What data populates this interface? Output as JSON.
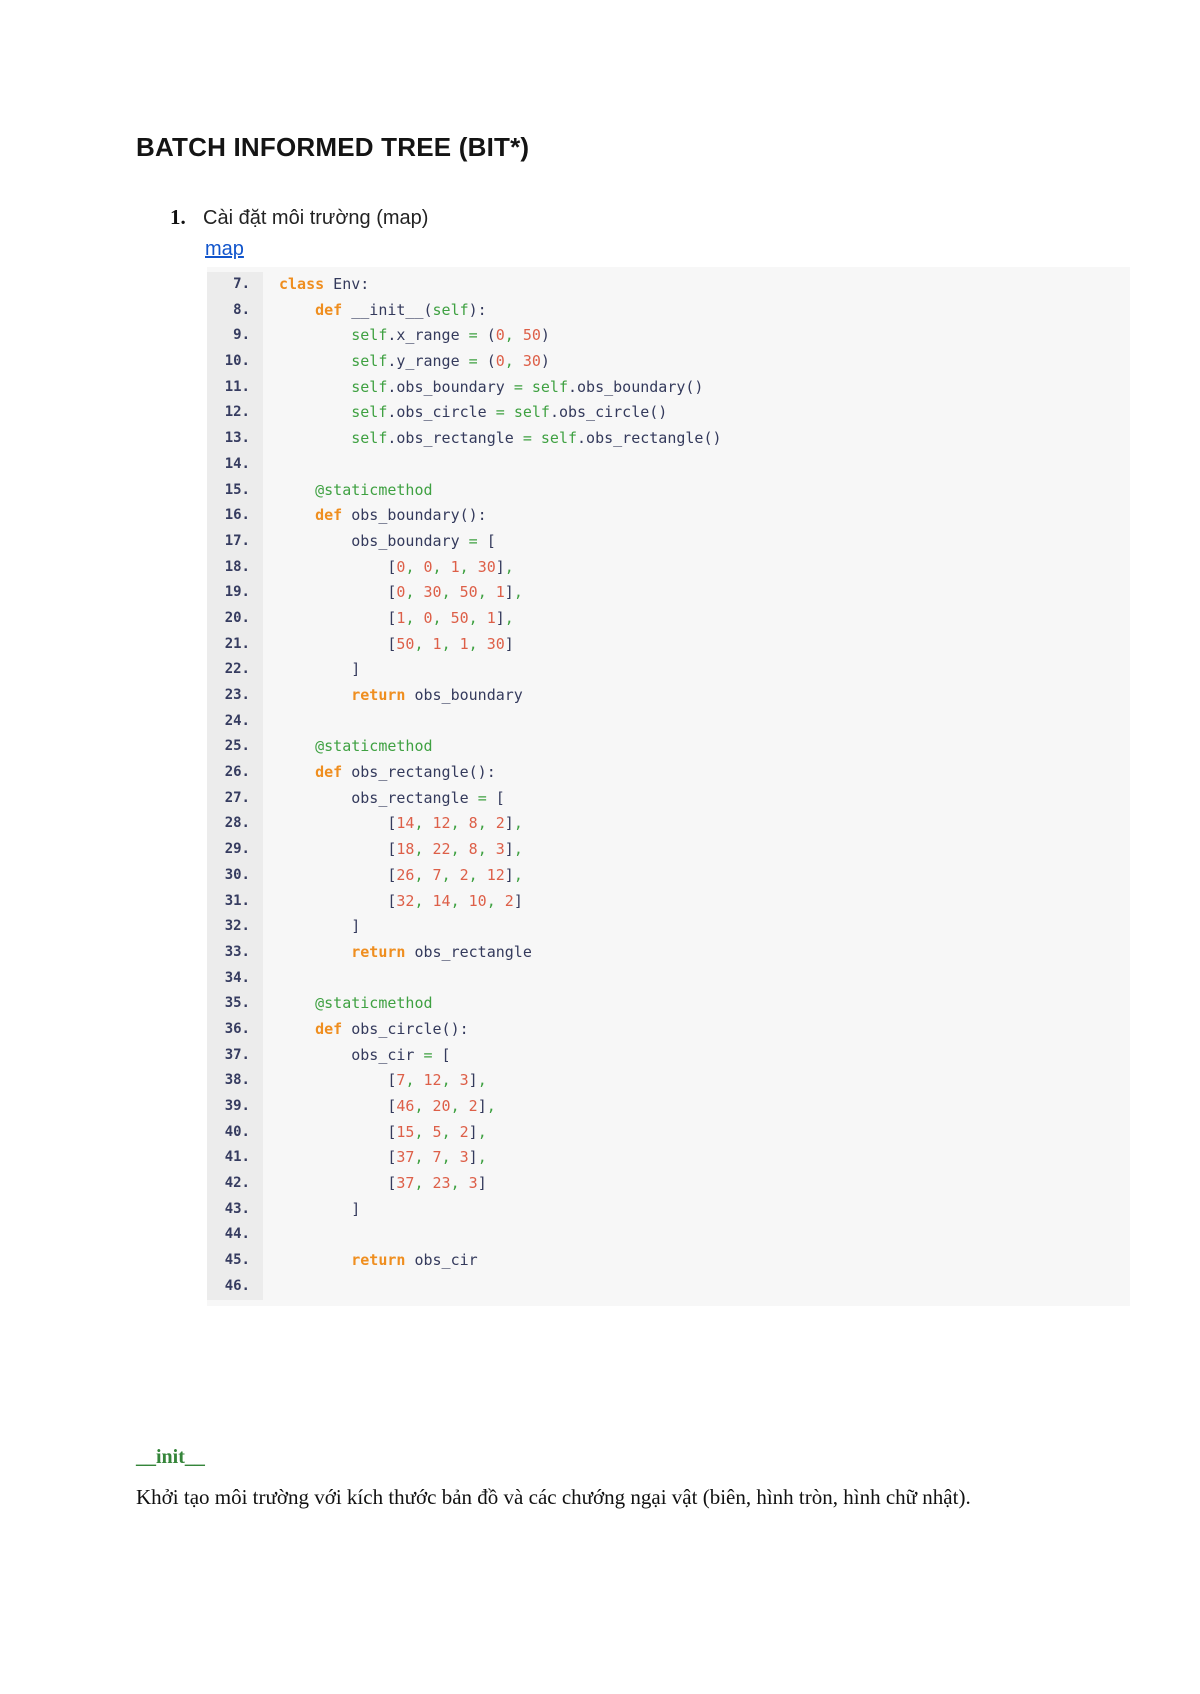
{
  "page": {
    "title": "BATCH INFORMED TREE (BIT*)",
    "list_item": {
      "number": "1.",
      "text": "Cài đặt môi trường (map)"
    },
    "link_label": "map"
  },
  "colors": {
    "keyword": "#ef8e1f",
    "number": "#dd5f48",
    "green": "#3fa142",
    "code_default": "#343a5c",
    "line_number": "#363c60",
    "code_bg": "#f7f7f7",
    "gutter_bg": "#ececec",
    "link": "#1155cc",
    "init_green": "#35853a"
  },
  "code_block": {
    "language": "python",
    "lines": [
      {
        "no": "7.",
        "segs": [
          [
            "k",
            "class"
          ],
          [
            "d",
            " Env:"
          ]
        ]
      },
      {
        "no": "8.",
        "segs": [
          [
            "d",
            "    "
          ],
          [
            "k",
            "def"
          ],
          [
            "d",
            " __init__("
          ],
          [
            "g",
            "self"
          ],
          [
            "d",
            "):"
          ]
        ]
      },
      {
        "no": "9.",
        "segs": [
          [
            "d",
            "        "
          ],
          [
            "g",
            "self"
          ],
          [
            "d",
            ".x_range "
          ],
          [
            "g",
            "="
          ],
          [
            "d",
            " ("
          ],
          [
            "n",
            "0"
          ],
          [
            "g",
            ","
          ],
          [
            "d",
            " "
          ],
          [
            "n",
            "50"
          ],
          [
            "d",
            ")"
          ]
        ]
      },
      {
        "no": "10.",
        "segs": [
          [
            "d",
            "        "
          ],
          [
            "g",
            "self"
          ],
          [
            "d",
            ".y_range "
          ],
          [
            "g",
            "="
          ],
          [
            "d",
            " ("
          ],
          [
            "n",
            "0"
          ],
          [
            "g",
            ","
          ],
          [
            "d",
            " "
          ],
          [
            "n",
            "30"
          ],
          [
            "d",
            ")"
          ]
        ]
      },
      {
        "no": "11.",
        "segs": [
          [
            "d",
            "        "
          ],
          [
            "g",
            "self"
          ],
          [
            "d",
            ".obs_boundary "
          ],
          [
            "g",
            "="
          ],
          [
            "d",
            " "
          ],
          [
            "g",
            "self"
          ],
          [
            "d",
            ".obs_boundary()"
          ]
        ]
      },
      {
        "no": "12.",
        "segs": [
          [
            "d",
            "        "
          ],
          [
            "g",
            "self"
          ],
          [
            "d",
            ".obs_circle "
          ],
          [
            "g",
            "="
          ],
          [
            "d",
            " "
          ],
          [
            "g",
            "self"
          ],
          [
            "d",
            ".obs_circle()"
          ]
        ]
      },
      {
        "no": "13.",
        "segs": [
          [
            "d",
            "        "
          ],
          [
            "g",
            "self"
          ],
          [
            "d",
            ".obs_rectangle "
          ],
          [
            "g",
            "="
          ],
          [
            "d",
            " "
          ],
          [
            "g",
            "self"
          ],
          [
            "d",
            ".obs_rectangle()"
          ]
        ]
      },
      {
        "no": "14.",
        "segs": []
      },
      {
        "no": "15.",
        "segs": [
          [
            "d",
            "    "
          ],
          [
            "g",
            "@staticmethod"
          ]
        ]
      },
      {
        "no": "16.",
        "segs": [
          [
            "d",
            "    "
          ],
          [
            "k",
            "def"
          ],
          [
            "d",
            " obs_boundary():"
          ]
        ]
      },
      {
        "no": "17.",
        "segs": [
          [
            "d",
            "        obs_boundary "
          ],
          [
            "g",
            "="
          ],
          [
            "d",
            " ["
          ]
        ]
      },
      {
        "no": "18.",
        "segs": [
          [
            "d",
            "            ["
          ],
          [
            "n",
            "0"
          ],
          [
            "g",
            ","
          ],
          [
            "d",
            " "
          ],
          [
            "n",
            "0"
          ],
          [
            "g",
            ","
          ],
          [
            "d",
            " "
          ],
          [
            "n",
            "1"
          ],
          [
            "g",
            ","
          ],
          [
            "d",
            " "
          ],
          [
            "n",
            "30"
          ],
          [
            "d",
            "]"
          ],
          [
            "g",
            ","
          ]
        ]
      },
      {
        "no": "19.",
        "segs": [
          [
            "d",
            "            ["
          ],
          [
            "n",
            "0"
          ],
          [
            "g",
            ","
          ],
          [
            "d",
            " "
          ],
          [
            "n",
            "30"
          ],
          [
            "g",
            ","
          ],
          [
            "d",
            " "
          ],
          [
            "n",
            "50"
          ],
          [
            "g",
            ","
          ],
          [
            "d",
            " "
          ],
          [
            "n",
            "1"
          ],
          [
            "d",
            "]"
          ],
          [
            "g",
            ","
          ]
        ]
      },
      {
        "no": "20.",
        "segs": [
          [
            "d",
            "            ["
          ],
          [
            "n",
            "1"
          ],
          [
            "g",
            ","
          ],
          [
            "d",
            " "
          ],
          [
            "n",
            "0"
          ],
          [
            "g",
            ","
          ],
          [
            "d",
            " "
          ],
          [
            "n",
            "50"
          ],
          [
            "g",
            ","
          ],
          [
            "d",
            " "
          ],
          [
            "n",
            "1"
          ],
          [
            "d",
            "]"
          ],
          [
            "g",
            ","
          ]
        ]
      },
      {
        "no": "21.",
        "segs": [
          [
            "d",
            "            ["
          ],
          [
            "n",
            "50"
          ],
          [
            "g",
            ","
          ],
          [
            "d",
            " "
          ],
          [
            "n",
            "1"
          ],
          [
            "g",
            ","
          ],
          [
            "d",
            " "
          ],
          [
            "n",
            "1"
          ],
          [
            "g",
            ","
          ],
          [
            "d",
            " "
          ],
          [
            "n",
            "30"
          ],
          [
            "d",
            "]"
          ]
        ]
      },
      {
        "no": "22.",
        "segs": [
          [
            "d",
            "        ]"
          ]
        ]
      },
      {
        "no": "23.",
        "segs": [
          [
            "d",
            "        "
          ],
          [
            "k",
            "return"
          ],
          [
            "d",
            " obs_boundary"
          ]
        ]
      },
      {
        "no": "24.",
        "segs": []
      },
      {
        "no": "25.",
        "segs": [
          [
            "d",
            "    "
          ],
          [
            "g",
            "@staticmethod"
          ]
        ]
      },
      {
        "no": "26.",
        "segs": [
          [
            "d",
            "    "
          ],
          [
            "k",
            "def"
          ],
          [
            "d",
            " obs_rectangle():"
          ]
        ]
      },
      {
        "no": "27.",
        "segs": [
          [
            "d",
            "        obs_rectangle "
          ],
          [
            "g",
            "="
          ],
          [
            "d",
            " ["
          ]
        ]
      },
      {
        "no": "28.",
        "segs": [
          [
            "d",
            "            ["
          ],
          [
            "n",
            "14"
          ],
          [
            "g",
            ","
          ],
          [
            "d",
            " "
          ],
          [
            "n",
            "12"
          ],
          [
            "g",
            ","
          ],
          [
            "d",
            " "
          ],
          [
            "n",
            "8"
          ],
          [
            "g",
            ","
          ],
          [
            "d",
            " "
          ],
          [
            "n",
            "2"
          ],
          [
            "d",
            "]"
          ],
          [
            "g",
            ","
          ]
        ]
      },
      {
        "no": "29.",
        "segs": [
          [
            "d",
            "            ["
          ],
          [
            "n",
            "18"
          ],
          [
            "g",
            ","
          ],
          [
            "d",
            " "
          ],
          [
            "n",
            "22"
          ],
          [
            "g",
            ","
          ],
          [
            "d",
            " "
          ],
          [
            "n",
            "8"
          ],
          [
            "g",
            ","
          ],
          [
            "d",
            " "
          ],
          [
            "n",
            "3"
          ],
          [
            "d",
            "]"
          ],
          [
            "g",
            ","
          ]
        ]
      },
      {
        "no": "30.",
        "segs": [
          [
            "d",
            "            ["
          ],
          [
            "n",
            "26"
          ],
          [
            "g",
            ","
          ],
          [
            "d",
            " "
          ],
          [
            "n",
            "7"
          ],
          [
            "g",
            ","
          ],
          [
            "d",
            " "
          ],
          [
            "n",
            "2"
          ],
          [
            "g",
            ","
          ],
          [
            "d",
            " "
          ],
          [
            "n",
            "12"
          ],
          [
            "d",
            "]"
          ],
          [
            "g",
            ","
          ]
        ]
      },
      {
        "no": "31.",
        "segs": [
          [
            "d",
            "            ["
          ],
          [
            "n",
            "32"
          ],
          [
            "g",
            ","
          ],
          [
            "d",
            " "
          ],
          [
            "n",
            "14"
          ],
          [
            "g",
            ","
          ],
          [
            "d",
            " "
          ],
          [
            "n",
            "10"
          ],
          [
            "g",
            ","
          ],
          [
            "d",
            " "
          ],
          [
            "n",
            "2"
          ],
          [
            "d",
            "]"
          ]
        ]
      },
      {
        "no": "32.",
        "segs": [
          [
            "d",
            "        ]"
          ]
        ]
      },
      {
        "no": "33.",
        "segs": [
          [
            "d",
            "        "
          ],
          [
            "k",
            "return"
          ],
          [
            "d",
            " obs_rectangle"
          ]
        ]
      },
      {
        "no": "34.",
        "segs": []
      },
      {
        "no": "35.",
        "segs": [
          [
            "d",
            "    "
          ],
          [
            "g",
            "@staticmethod"
          ]
        ]
      },
      {
        "no": "36.",
        "segs": [
          [
            "d",
            "    "
          ],
          [
            "k",
            "def"
          ],
          [
            "d",
            " obs_circle():"
          ]
        ]
      },
      {
        "no": "37.",
        "segs": [
          [
            "d",
            "        obs_cir "
          ],
          [
            "g",
            "="
          ],
          [
            "d",
            " ["
          ]
        ]
      },
      {
        "no": "38.",
        "segs": [
          [
            "d",
            "            ["
          ],
          [
            "n",
            "7"
          ],
          [
            "g",
            ","
          ],
          [
            "d",
            " "
          ],
          [
            "n",
            "12"
          ],
          [
            "g",
            ","
          ],
          [
            "d",
            " "
          ],
          [
            "n",
            "3"
          ],
          [
            "d",
            "]"
          ],
          [
            "g",
            ","
          ]
        ]
      },
      {
        "no": "39.",
        "segs": [
          [
            "d",
            "            ["
          ],
          [
            "n",
            "46"
          ],
          [
            "g",
            ","
          ],
          [
            "d",
            " "
          ],
          [
            "n",
            "20"
          ],
          [
            "g",
            ","
          ],
          [
            "d",
            " "
          ],
          [
            "n",
            "2"
          ],
          [
            "d",
            "]"
          ],
          [
            "g",
            ","
          ]
        ]
      },
      {
        "no": "40.",
        "segs": [
          [
            "d",
            "            ["
          ],
          [
            "n",
            "15"
          ],
          [
            "g",
            ","
          ],
          [
            "d",
            " "
          ],
          [
            "n",
            "5"
          ],
          [
            "g",
            ","
          ],
          [
            "d",
            " "
          ],
          [
            "n",
            "2"
          ],
          [
            "d",
            "]"
          ],
          [
            "g",
            ","
          ]
        ]
      },
      {
        "no": "41.",
        "segs": [
          [
            "d",
            "            ["
          ],
          [
            "n",
            "37"
          ],
          [
            "g",
            ","
          ],
          [
            "d",
            " "
          ],
          [
            "n",
            "7"
          ],
          [
            "g",
            ","
          ],
          [
            "d",
            " "
          ],
          [
            "n",
            "3"
          ],
          [
            "d",
            "]"
          ],
          [
            "g",
            ","
          ]
        ]
      },
      {
        "no": "42.",
        "segs": [
          [
            "d",
            "            ["
          ],
          [
            "n",
            "37"
          ],
          [
            "g",
            ","
          ],
          [
            "d",
            " "
          ],
          [
            "n",
            "23"
          ],
          [
            "g",
            ","
          ],
          [
            "d",
            " "
          ],
          [
            "n",
            "3"
          ],
          [
            "d",
            "]"
          ]
        ]
      },
      {
        "no": "43.",
        "segs": [
          [
            "d",
            "        ]"
          ]
        ]
      },
      {
        "no": "44.",
        "segs": []
      },
      {
        "no": "45.",
        "segs": [
          [
            "d",
            "        "
          ],
          [
            "k",
            "return"
          ],
          [
            "d",
            " obs_cir"
          ]
        ]
      },
      {
        "no": "46.",
        "segs": []
      }
    ]
  },
  "footer": {
    "init_label": "__init__",
    "description": " Khởi tạo môi trường với kích thước bản đồ và các chướng ngại vật (biên, hình tròn, hình chữ nhật)."
  }
}
